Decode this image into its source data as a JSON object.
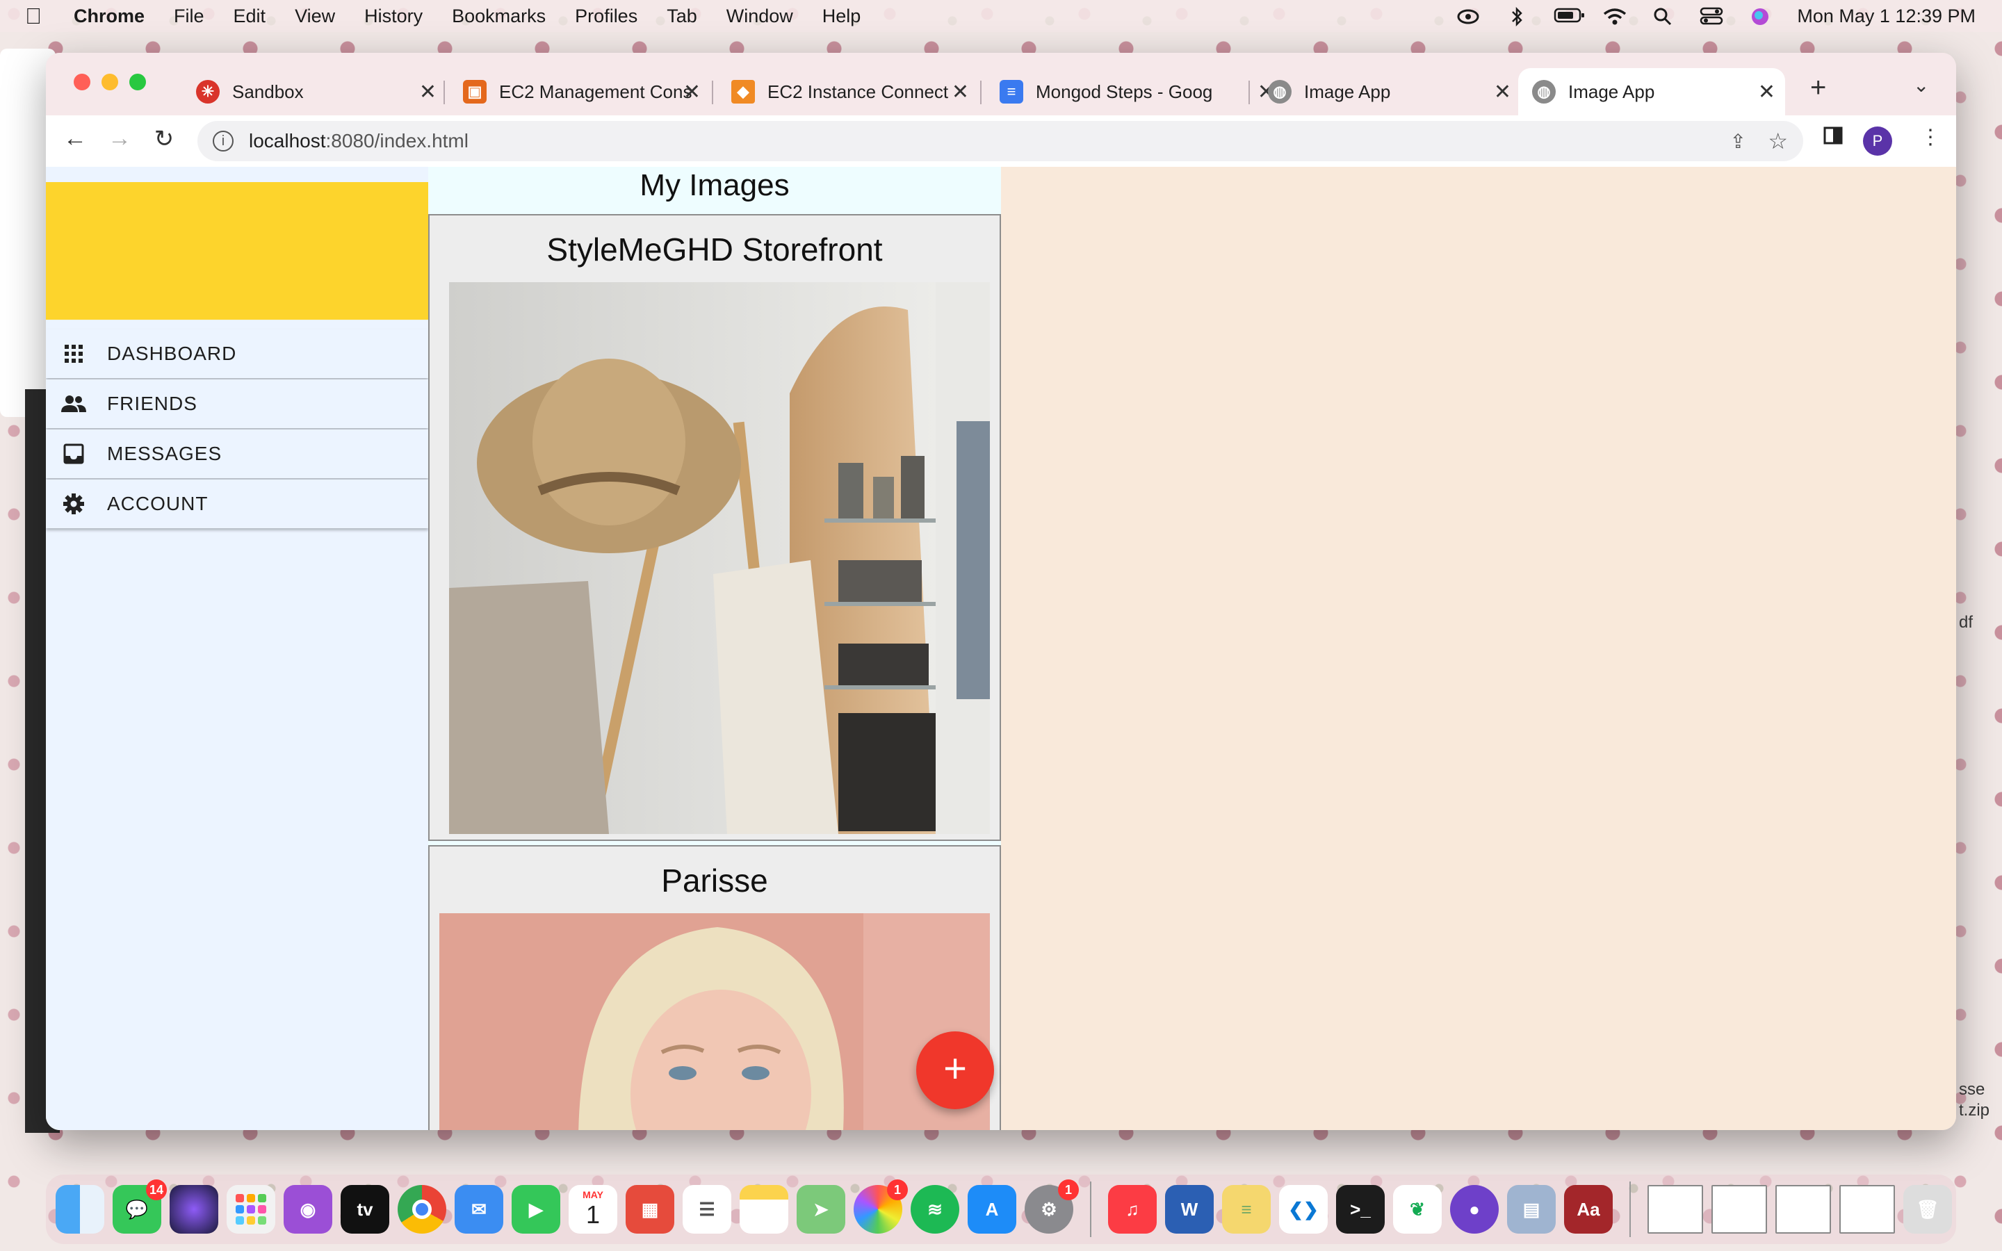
{
  "menubar": {
    "app": "Chrome",
    "items": [
      "File",
      "Edit",
      "View",
      "History",
      "Bookmarks",
      "Profiles",
      "Tab",
      "Window",
      "Help"
    ],
    "clock": "Mon May 1  12:39 PM"
  },
  "browser": {
    "tabs": [
      {
        "title": "Sandbox",
        "icon": "sandbox-icon",
        "color": "#d9342b"
      },
      {
        "title": "EC2 Management Cons",
        "icon": "aws-console-icon",
        "color": "#e4681c"
      },
      {
        "title": "EC2 Instance Connect",
        "icon": "aws-ec2-icon",
        "color": "#f08a24"
      },
      {
        "title": "Mongod Steps - Googl",
        "icon": "google-docs-icon",
        "color": "#3a7af0"
      },
      {
        "title": "Image App",
        "icon": "globe-icon",
        "color": "#777777"
      },
      {
        "title": "Image App",
        "icon": "globe-icon",
        "color": "#777777"
      }
    ],
    "url_host": "localhost",
    "url_path": ":8080/index.html",
    "profile_initial": "P"
  },
  "sidebar": {
    "items": [
      {
        "label": "DASHBOARD",
        "icon": "grid-icon"
      },
      {
        "label": "FRIENDS",
        "icon": "people-icon"
      },
      {
        "label": "MESSAGES",
        "icon": "inbox-icon"
      },
      {
        "label": "ACCOUNT",
        "icon": "gear-icon"
      }
    ],
    "header_color": "#fdd42c"
  },
  "main": {
    "title": "My Images",
    "cards": [
      {
        "title": "StyleMeGHD Storefront"
      },
      {
        "title": "Parisse"
      }
    ],
    "fab_label": "+"
  },
  "dock": {
    "badges": {
      "messages": "14",
      "photos": "1",
      "settings": "1"
    },
    "calendar_month": "MAY",
    "calendar_day": "1"
  },
  "desktop": {
    "file_a": "df",
    "file_b1": "sse",
    "file_b2": "t.zip"
  }
}
